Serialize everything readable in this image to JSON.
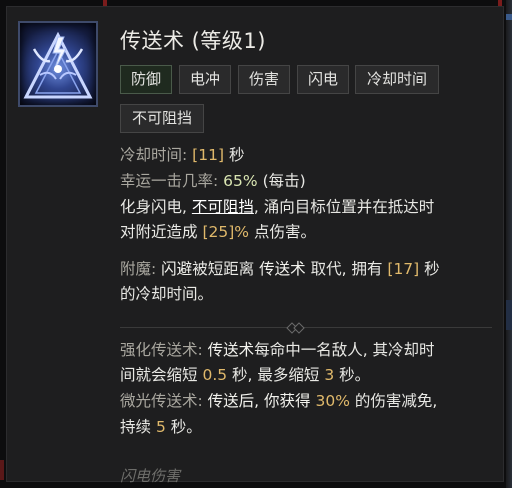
{
  "skill": {
    "name": "传送术 (等级1)",
    "icon": "lightning-crest-icon"
  },
  "tags": [
    "防御",
    "电冲",
    "伤害",
    "闪电",
    "冷却时间",
    "不可阻挡"
  ],
  "stats": {
    "cooldown_label": "冷却时间:",
    "cooldown_value": "[11]",
    "cooldown_unit": "秒",
    "luck_label": "幸运一击几率:",
    "luck_value": "65%",
    "luck_suffix": "(每击)"
  },
  "description": {
    "line1_a": "化身闪电,",
    "line1_keyword": "不可阻挡",
    "line1_b": ", 涌向目标位置并在抵达时",
    "line2_a": "对附近造成",
    "line2_value": "[25]%",
    "line2_b": "点伤害。"
  },
  "enchant": {
    "label": "附魔:",
    "a": "闪避",
    "b": "被短距离",
    "c": "传送术",
    "d": "取代, 拥有",
    "value": "[17]",
    "e": "秒",
    "line2": "的冷却时间。"
  },
  "upgrades": [
    {
      "label": "强化传送术:",
      "a": "传送术",
      "b": "每命中一名敌人, 其冷却时",
      "line2_a": "间就会缩短",
      "value1": "0.5",
      "line2_b": "秒, 最多缩短",
      "value2": "3",
      "line2_c": "秒。"
    },
    {
      "label": "微光传送术:",
      "a": "传送后, 你获得",
      "value1": "30%",
      "b": "的伤害减免,",
      "line2_a": "持续",
      "value2": "5",
      "line2_b": "秒。"
    }
  ],
  "footer": "闪电伤害"
}
